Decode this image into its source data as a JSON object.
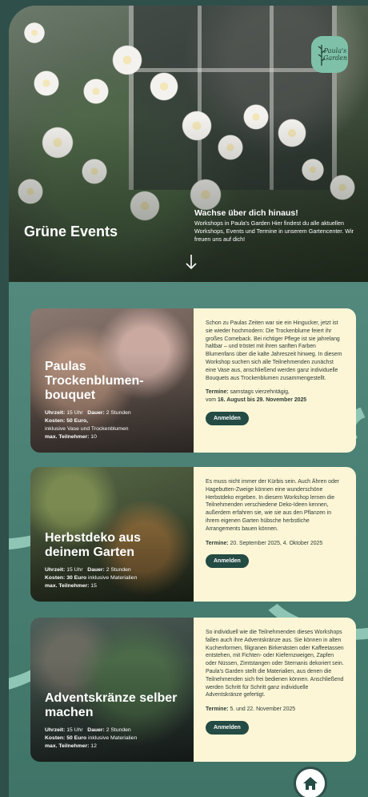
{
  "hero": {
    "title": "Grüne Events",
    "headline": "Wachse über dich hinaus!",
    "text": "Workshops in Paula's Garden Hier findest du alle aktuellen Workshops, Events und Termine in unserem Gartencenter. Wir freuen uns auf dich!",
    "logo_text_1": "Paula's",
    "logo_text_2": "Garden",
    "scroll_icon": "arrow-down-icon"
  },
  "workshops": [
    {
      "title": "Paulas Trockenblumen-bouquet",
      "uhrzeit_label": "Uhrzeit:",
      "uhrzeit": "15 Uhr",
      "dauer_label": "Dauer:",
      "dauer": "2 Stunden",
      "kosten_label": "Kosten:",
      "kosten": "50 Euro,",
      "kosten_extra": "inklusive Vase und Trockenblumen",
      "teilnehmer_label": "max. Teilnehmer:",
      "teilnehmer": "10",
      "description": "Schon zu Paulas Zeiten war sie ein Hingucker, jetzt ist sie wieder hochmodern: Die Trockenblume feiert ihr großes Comeback. Bei richtiger Pflege ist sie jahrelang haltbar – und tröstet mit ihren sanften Farben Blumenfans über die kalte Jahreszeit hinweg. In diesem Workshop suchen sich alle Teilnehmenden zunächst eine Vase aus, anschließend werden ganz individuelle Bouquets aus Trockenblumen zusammengestellt.",
      "termine_label": "Termine:",
      "termine": "samstags vierzehntägig,",
      "termine_2": "vom",
      "termine_bold": "16. August bis 29. November 2025",
      "button": "Anmelden"
    },
    {
      "title": "Herbstdeko aus deinem Garten",
      "uhrzeit_label": "Uhrzeit:",
      "uhrzeit": "15 Uhr",
      "dauer_label": "Dauer:",
      "dauer": "2 Stunden",
      "kosten_label": "Kosten:",
      "kosten": "30 Euro",
      "kosten_extra": "inklusive Materialien",
      "teilnehmer_label": "max. Teilnehmer:",
      "teilnehmer": "15",
      "description": "Es muss nicht immer der Kürbis sein. Auch Ähren oder Hagebutten-Zweige können eine wunderschöne Herbstdeko ergeben. In diesem Workshop lernen die Teilnehmenden verschiedene Deko-Ideen kennen, außerdem erfahren sie, wie sie aus den Pflanzen in ihrem eigenen Garten hübsche herbstliche Arrangements bauen können.",
      "termine_label": "Termine:",
      "termine": "20. September 2025, 4. Oktober 2025",
      "button": "Anmelden"
    },
    {
      "title": "Adventskränze selber machen",
      "uhrzeit_label": "Uhrzeit:",
      "uhrzeit": "15 Uhr",
      "dauer_label": "Dauer:",
      "dauer": "2 Stunden",
      "kosten_label": "Kosten:",
      "kosten": "50 Euro",
      "kosten_extra": "inklusive Materialien",
      "teilnehmer_label": "max. Teilnehmer:",
      "teilnehmer": "12",
      "description": "So individuell wie die Teilnehmenden dieses Workshops fallen auch ihre Adventskränze aus. Sie können in alten Kuchenformen, filigranen Birkenästen oder Kaffeetassen entstehen, mit Fichten- oder Kiefernzweigen, Zapfen oder Nüssen, Zimtstangen oder Sternanis dekoriert sein. Paula's Garden stellt die Materialien, aus denen die Teilnehmenden sich frei bedienen können. Anschließend werden Schritt für Schritt ganz individuelle Adventskränze gefertigt.",
      "termine_label": "Termine:",
      "termine": "5. und 22. November 2025",
      "button": "Anmelden"
    }
  ],
  "footer": {
    "home_icon": "home-icon"
  },
  "colors": {
    "background": "#2f4f4a",
    "teal": "#5f9488",
    "cream": "#fdf6d6",
    "button": "#244b44",
    "logo": "#7ec1a8"
  }
}
